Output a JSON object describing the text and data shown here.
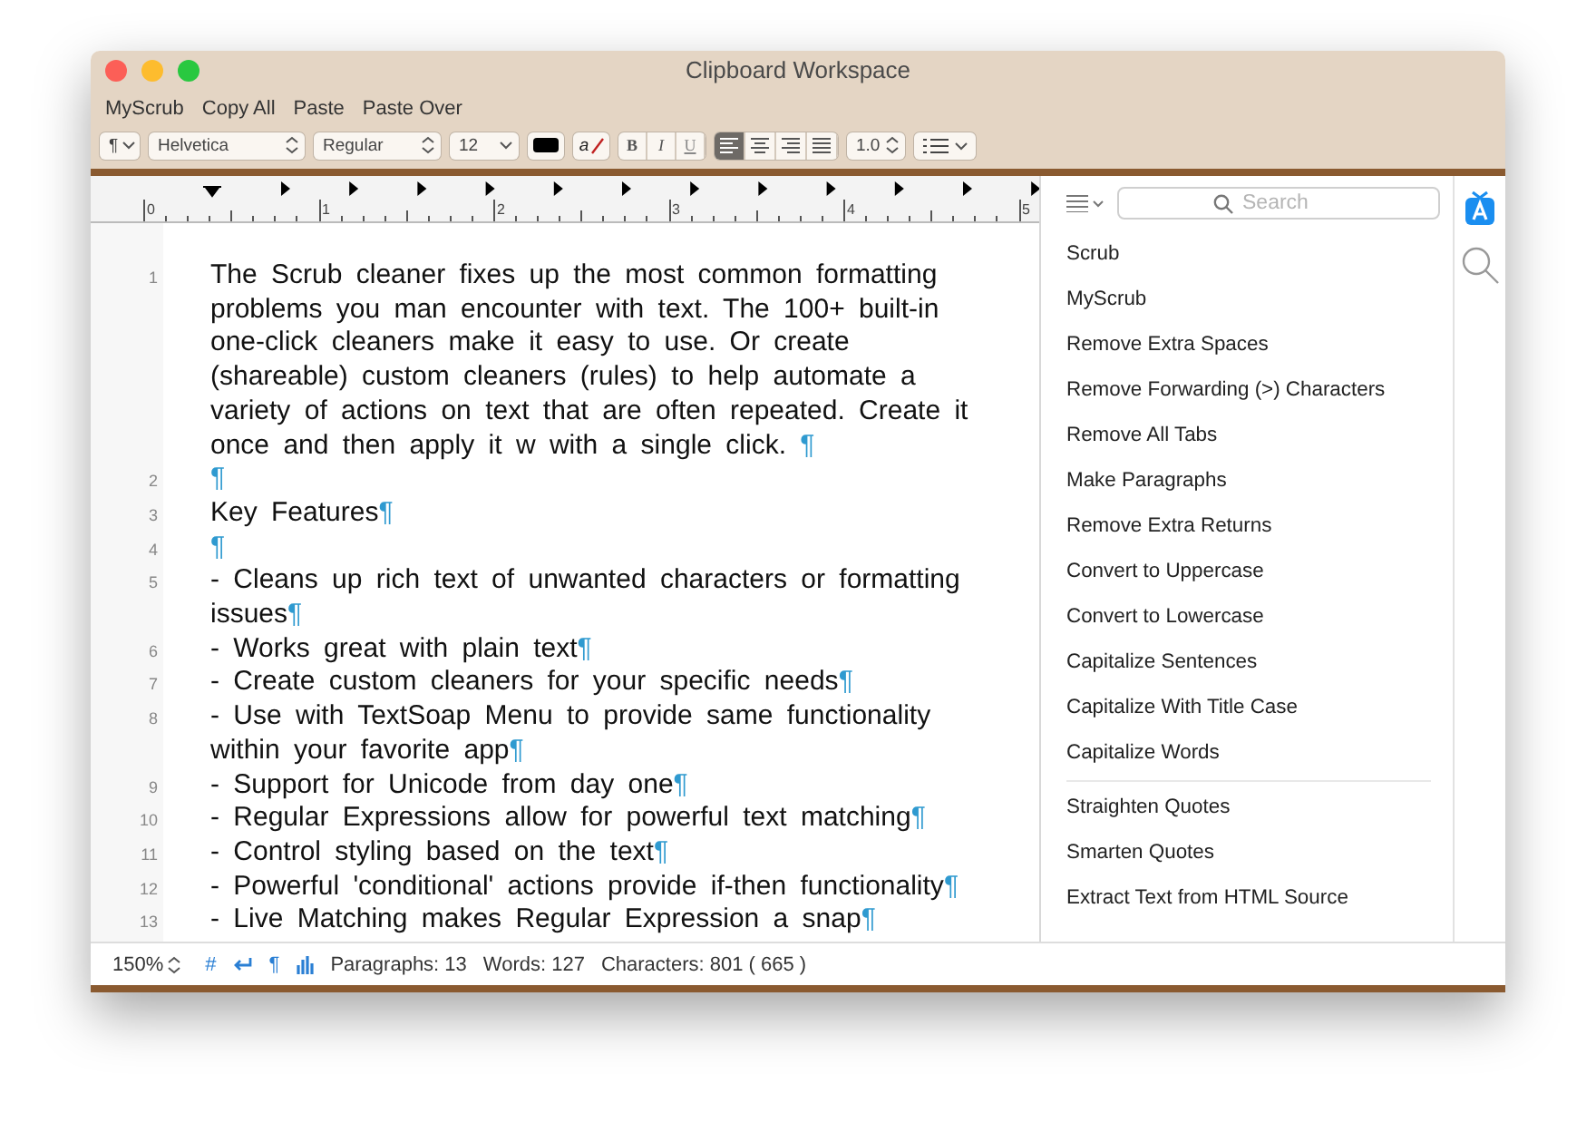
{
  "window": {
    "title": "Clipboard Workspace"
  },
  "menu_bar": [
    "MyScrub",
    "Copy All",
    "Paste",
    "Paste Over"
  ],
  "format_bar": {
    "paragraph_style": "¶",
    "font": "Helvetica",
    "typeface": "Regular",
    "size": "12",
    "strike_label": "a",
    "styles": [
      "B",
      "I",
      "U"
    ],
    "alignments": [
      {
        "kind": "left",
        "selected": true
      },
      {
        "kind": "center",
        "selected": false
      },
      {
        "kind": "right",
        "selected": false
      },
      {
        "kind": "justify",
        "selected": false
      }
    ],
    "line_spacing": "1.0"
  },
  "ruler": {
    "labels": [
      "0",
      "1",
      "2",
      "3",
      "4",
      "5"
    ]
  },
  "document": {
    "lines": [
      {
        "number": "1",
        "text": "The Scrub cleaner fixes up the most common formatting problems you man encounter with text. The 100+ built-in one-click cleaners make it easy to use. Or create (shareable) custom cleaners (rules) to help automate a variety of actions on text that are often repeated. Create it once and then apply it w with a single click. ",
        "mark": "¶"
      },
      {
        "number": "2",
        "mark": "¶"
      },
      {
        "number": "3",
        "text": "Key Features",
        "mark": "¶"
      },
      {
        "number": "4",
        "mark": "¶"
      },
      {
        "number": "5",
        "text": "- Cleans up rich text of unwanted characters or formatting issues",
        "mark": "¶"
      },
      {
        "number": "6",
        "text": "- Works great with plain text",
        "mark": "¶"
      },
      {
        "number": "7",
        "text": "- Create custom cleaners for your specific needs",
        "mark": "¶"
      },
      {
        "number": "8",
        "text": "- Use with TextSoap Menu to provide same functionality within your favorite app",
        "mark": "¶"
      },
      {
        "number": "9",
        "text": "- Support for Unicode from day one",
        "mark": "¶"
      },
      {
        "number": "10",
        "text": "- Regular Expressions allow for powerful text matching",
        "mark": "¶"
      },
      {
        "number": "11",
        "text": "- Control styling based on the text",
        "mark": "¶"
      },
      {
        "number": "12",
        "text": "- Powerful 'conditional' actions provide if-then functionality",
        "mark": "¶"
      },
      {
        "number": "13",
        "text": "- Live Matching makes Regular Expression a snap",
        "mark": "¶"
      }
    ]
  },
  "sidebar": {
    "search": {
      "placeholder": "Search"
    },
    "groups": [
      {
        "items": [
          "Scrub",
          "MyScrub",
          "Remove Extra Spaces",
          "Remove Forwarding (>) Characters",
          "Remove All Tabs",
          "Make Paragraphs",
          "Remove Extra Returns",
          "Convert to Uppercase",
          "Convert to Lowercase",
          "Capitalize Sentences",
          "Capitalize With Title Case",
          "Capitalize Words"
        ]
      },
      {
        "items": [
          "Straighten Quotes",
          "Smarten Quotes",
          "Extract Text from HTML Source"
        ]
      }
    ]
  },
  "status_bar": {
    "zoom": "150%",
    "hash": "#",
    "invisibles": "¶",
    "paragraphs": "Paragraphs: 13",
    "words": "Words: 127",
    "characters": "Characters: 801 ( 665 )"
  }
}
